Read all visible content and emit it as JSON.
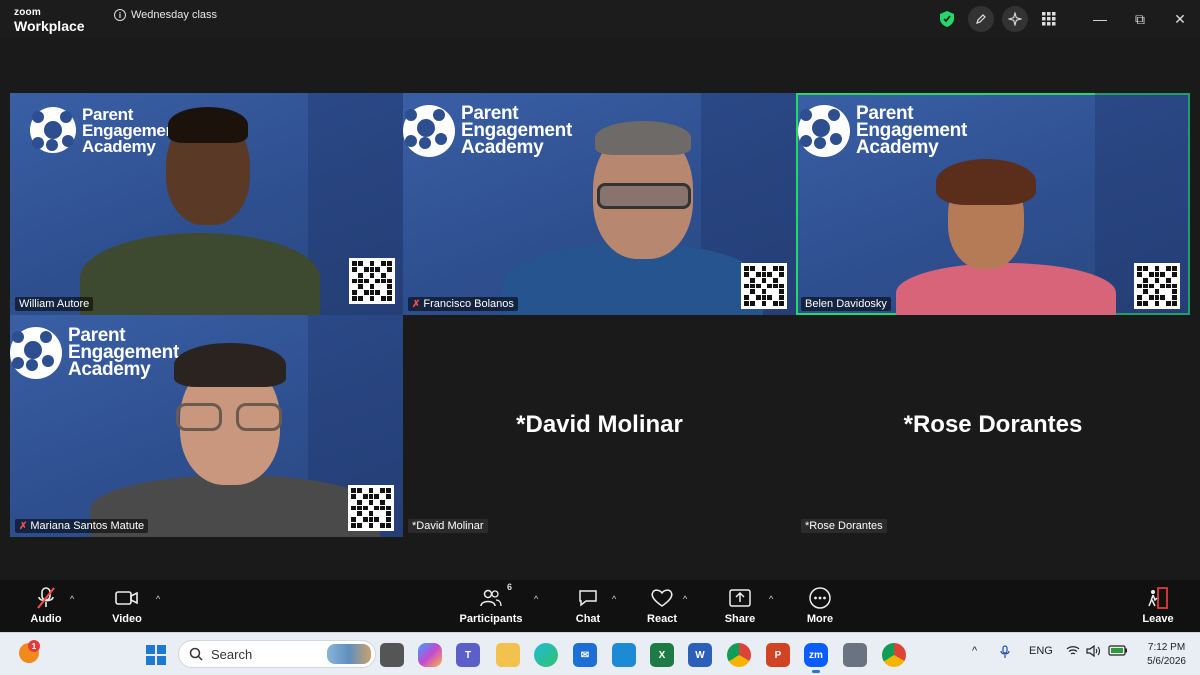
{
  "app": {
    "brand_small": "zoom",
    "brand_large": "Workplace",
    "meeting_title": "Wednesday class"
  },
  "tiles": [
    {
      "name": "William Autore",
      "muted": false,
      "active": false,
      "brand": [
        "Parent",
        "Engagement",
        "Academy"
      ]
    },
    {
      "name": "Francisco Bolanos",
      "muted": true,
      "active": false,
      "brand": [
        "Parent",
        "Engagement",
        "Academy"
      ]
    },
    {
      "name": "Belen Davidosky",
      "muted": false,
      "active": true,
      "brand": [
        "Parent",
        "Engagement",
        "Academy"
      ]
    },
    {
      "name": "Mariana Santos Matute",
      "muted": true,
      "active": false,
      "brand": [
        "Parent",
        "Engagement",
        "Academy"
      ]
    },
    {
      "name": "*David Molinar",
      "display": "*David Molinar",
      "video_off": true
    },
    {
      "name": "*Rose Dorantes",
      "display": "*Rose Dorantes",
      "video_off": true
    }
  ],
  "toolbar": {
    "audio": "Audio",
    "video": "Video",
    "participants": "Participants",
    "participants_count": "6",
    "chat": "Chat",
    "react": "React",
    "share": "Share",
    "more": "More",
    "leave": "Leave"
  },
  "taskbar": {
    "notification_badge": "1",
    "search_placeholder": "Search",
    "language": "ENG",
    "time": "7:12 PM",
    "date": "5/6/2026"
  },
  "colors": {
    "active_speaker": "#23d96c",
    "muted": "#ff4a4a",
    "brand_blue": "#2e4f8f",
    "leave": "#e23b3b"
  }
}
